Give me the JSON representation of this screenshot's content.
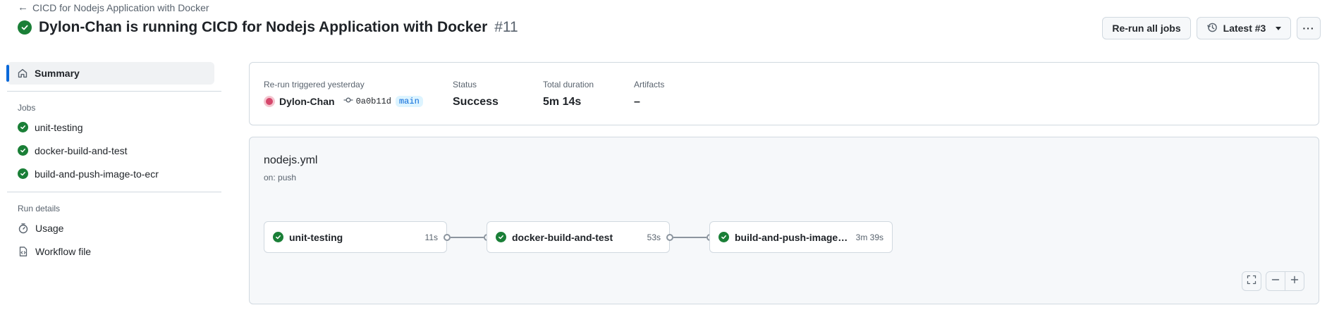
{
  "breadcrumb": {
    "back_icon": "arrow-left-icon",
    "label": "CICD for Nodejs Application with Docker"
  },
  "header": {
    "status_icon": "check-circle-icon",
    "title": "Dylon-Chan is running CICD for Nodejs Application with Docker",
    "run_number": "#11",
    "rerun_label": "Re-run all jobs",
    "attempt_icon": "history-icon",
    "attempt_label": "Latest #3",
    "more_label": "···"
  },
  "sidebar": {
    "summary_label": "Summary",
    "jobs_heading": "Jobs",
    "jobs": [
      {
        "label": "unit-testing"
      },
      {
        "label": "docker-build-and-test"
      },
      {
        "label": "build-and-push-image-to-ecr"
      }
    ],
    "run_details_heading": "Run details",
    "usage_label": "Usage",
    "workflow_file_label": "Workflow file"
  },
  "summary": {
    "trigger_label": "Re-run triggered yesterday",
    "actor": "Dylon-Chan",
    "commit": "0a0b11d",
    "branch": "main",
    "status_label": "Status",
    "status_value": "Success",
    "duration_label": "Total duration",
    "duration_value": "5m 14s",
    "artifacts_label": "Artifacts",
    "artifacts_value": "–"
  },
  "workflow": {
    "file": "nodejs.yml",
    "trigger": "on: push",
    "jobs": [
      {
        "name": "unit-testing",
        "duration": "11s"
      },
      {
        "name": "docker-build-and-test",
        "duration": "53s"
      },
      {
        "name": "build-and-push-image-to-ecr",
        "duration": "3m 39s"
      }
    ]
  },
  "colors": {
    "success": "#1a7f37",
    "accent": "#0969da"
  }
}
